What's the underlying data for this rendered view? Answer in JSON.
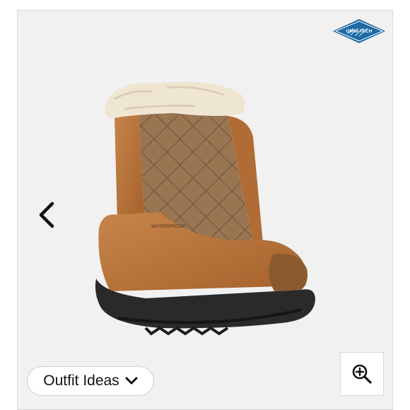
{
  "badge": {
    "text": "OMNI-TECH",
    "color": "#1f6aa5"
  },
  "product": {
    "imprint": "WATERPROOF"
  },
  "controls": {
    "prev_icon": "chevron-left-icon",
    "outfit_label": "Outfit Ideas",
    "outfit_icon": "chevron-down-icon",
    "zoom_icon": "zoom-in-icon"
  }
}
